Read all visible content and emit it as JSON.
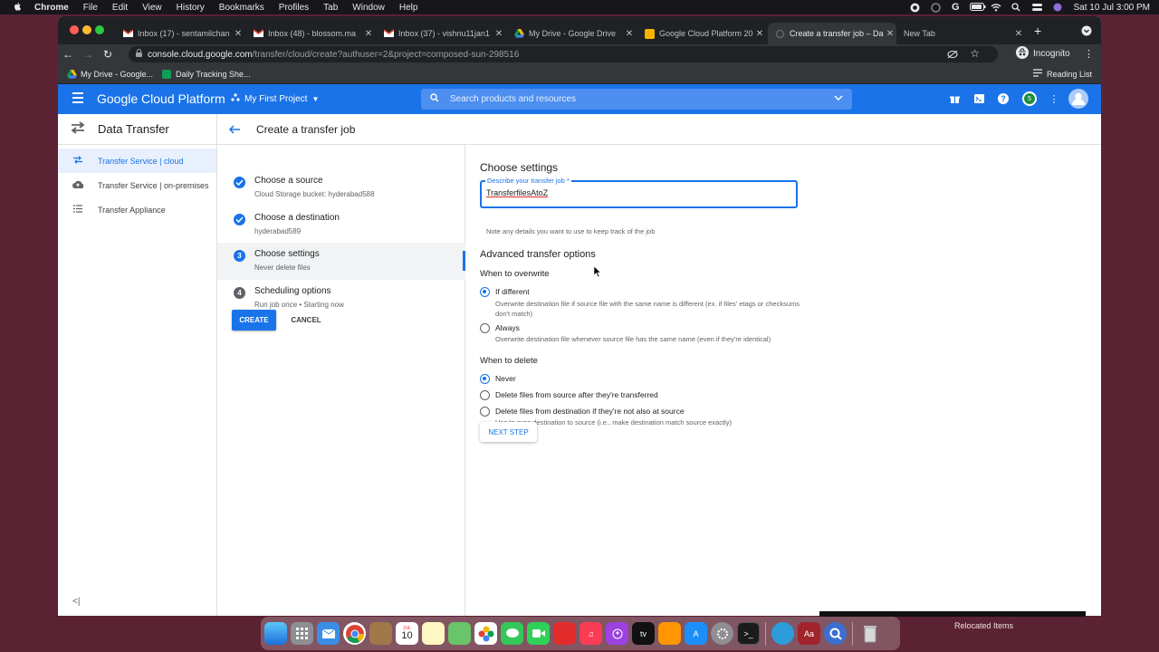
{
  "mac_menubar": {
    "app": "Chrome",
    "menus": [
      "File",
      "Edit",
      "View",
      "History",
      "Bookmarks",
      "Profiles",
      "Tab",
      "Window",
      "Help"
    ],
    "datetime": "Sat 10 Jul  3:00 PM"
  },
  "tabs": [
    {
      "title": "Inbox (17) - sentamilchan",
      "icon": "gmail-icon",
      "active": false
    },
    {
      "title": "Inbox (48) - blossom.ma",
      "icon": "gmail-icon",
      "active": false
    },
    {
      "title": "Inbox (37) - vishnu11jan1",
      "icon": "gmail-icon",
      "active": false
    },
    {
      "title": "My Drive - Google Drive",
      "icon": "drive-icon",
      "active": false
    },
    {
      "title": "Google Cloud Platform 20",
      "icon": "slides-icon",
      "active": false
    },
    {
      "title": "Create a transfer job – Da",
      "icon": "loading-icon",
      "active": true
    },
    {
      "title": "New Tab",
      "icon": "",
      "active": false
    }
  ],
  "toolbar": {
    "url_host": "console.cloud.google.com",
    "url_path": "/transfer/cloud/create?authuser=2&project=composed-sun-298516",
    "profile_label": "Incognito"
  },
  "bookmarks": {
    "items": [
      "My Drive - Google...",
      "Daily Tracking She..."
    ],
    "reading_list": "Reading List"
  },
  "gcp_header": {
    "title": "Google Cloud Platform",
    "project": "My First Project",
    "search_placeholder": "Search products and resources",
    "notifications_count": "5"
  },
  "sidebar": {
    "title": "Data Transfer",
    "items": [
      {
        "label": "Transfer Service | cloud",
        "active": true
      },
      {
        "label": "Transfer Service | on-premises",
        "active": false
      },
      {
        "label": "Transfer Appliance",
        "active": false
      }
    ],
    "collapse_label": "<|"
  },
  "page": {
    "title": "Create a transfer job"
  },
  "steps": [
    {
      "number": "1",
      "title": "Choose a source",
      "subtitle": "Cloud Storage bucket: hyderabad588",
      "state": "done"
    },
    {
      "number": "2",
      "title": "Choose a destination",
      "subtitle": "hyderabad589",
      "state": "done"
    },
    {
      "number": "3",
      "title": "Choose settings",
      "subtitle": "Never delete files",
      "state": "current"
    },
    {
      "number": "4",
      "title": "Scheduling options",
      "subtitle": "Run job once • Starting now",
      "state": "todo"
    }
  ],
  "actions": {
    "create": "CREATE",
    "cancel": "CANCEL"
  },
  "settings": {
    "heading": "Choose settings",
    "desc_label": "Describe your transfer job *",
    "desc_value": "TransferfilesAtoZ",
    "desc_hint": "Note any details you want to use to keep track of the job",
    "advanced_heading": "Advanced transfer options",
    "overwrite_heading": "When to overwrite",
    "overwrite_options": [
      {
        "label": "If different",
        "desc": "Overwrite destination file if source file with the same name is different (ex. if files' etags or checksums don't match)",
        "selected": true
      },
      {
        "label": "Always",
        "desc": "Overwrite destination file whenever source file has the same name (even if they're identical)",
        "selected": false
      }
    ],
    "delete_heading": "When to delete",
    "delete_options": [
      {
        "label": "Never",
        "desc": "",
        "selected": true
      },
      {
        "label": "Delete files from source after they're transferred",
        "desc": "",
        "selected": false
      },
      {
        "label": "Delete files from destination if they're not also at source",
        "desc": "Use to sync destination to source (i.e., make destination match source exactly)",
        "selected": false
      }
    ],
    "next_step": "NEXT STEP"
  },
  "dock": {
    "calendar_day": "10",
    "calendar_month": "JUL",
    "relocated_label": "Relocated Items"
  },
  "colors": {
    "gcp_blue": "#1a73e8",
    "desktop_bg": "#5b2233",
    "chrome_dark": "#202124"
  }
}
